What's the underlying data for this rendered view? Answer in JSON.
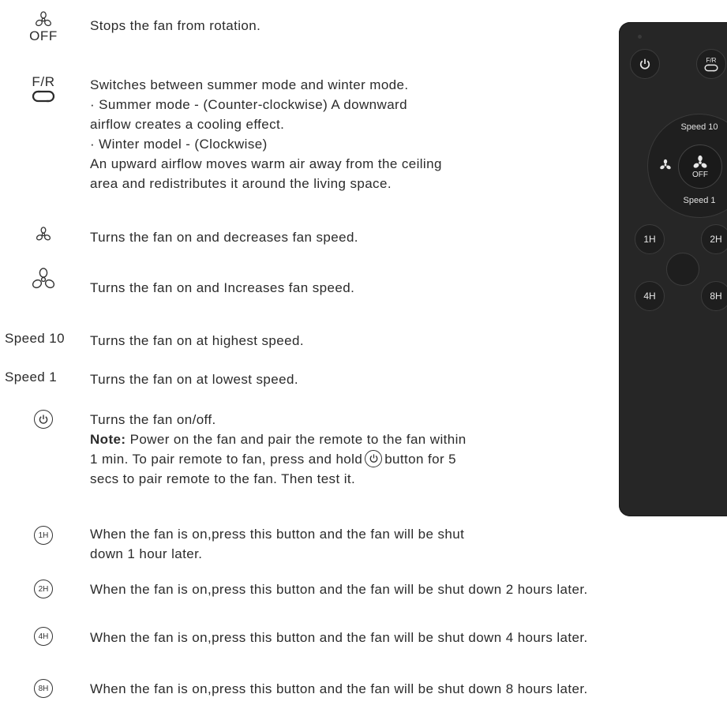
{
  "entries": {
    "off": {
      "icon_text": "OFF",
      "lines": [
        "Stops the fan from rotation."
      ]
    },
    "fr": {
      "icon_text": "F/R",
      "lines": [
        "Switches between summer mode and winter mode.",
        " · Summer mode - (Counter-clockwise) A downward",
        " airflow creates a cooling effect.",
        " · Winter model - (Clockwise)",
        "An upward airflow moves warm air away from the ceiling",
        "area and redistributes it around the living space."
      ]
    },
    "decrease": {
      "lines": [
        "Turns the fan on and decreases fan speed."
      ]
    },
    "increase": {
      "lines": [
        "Turns the fan on and Increases fan speed."
      ]
    },
    "speed10": {
      "label": "Speed 10",
      "lines": [
        "Turns the fan on at highest speed."
      ]
    },
    "speed1": {
      "label": "Speed 1",
      "lines": [
        "Turns the fan on at lowest speed."
      ]
    },
    "power": {
      "lines": [
        "Turns the fan on/off."
      ],
      "note_label": "Note:",
      "note_line1": " Power on the fan and pair the remote to the fan within",
      "note_line2_pre": "1 min. To pair remote to fan, press and hold",
      "note_line2_post": "button for 5",
      "note_line3": "secs to pair remote to the fan. Then test it."
    },
    "timer1h": {
      "icon_text": "1H",
      "lines": [
        "When the fan is on,press this button and the fan will be shut",
        "down 1 hour later."
      ]
    },
    "timer2h": {
      "icon_text": "2H",
      "lines": [
        "When the fan is on,press this button and the fan will be shut down 2 hours later."
      ]
    },
    "timer4h": {
      "icon_text": "4H",
      "lines": [
        "When the fan is on,press this button and the fan will be shut down 4 hours later."
      ]
    },
    "timer8h": {
      "icon_text": "8H",
      "lines": [
        "When the fan is on,press this button and the fan will be shut down 8 hours later."
      ]
    }
  },
  "remote": {
    "fr_label": "F/R",
    "speed_top": "Speed 10",
    "speed_bottom": "Speed 1",
    "center_label": "OFF",
    "timer_1h": "1H",
    "timer_2h": "2H",
    "timer_4h": "4H",
    "timer_8h": "8H"
  },
  "icons": {
    "fan": "fan-icon",
    "reverse": "reverse-arrows-icon",
    "power": "power-icon"
  }
}
